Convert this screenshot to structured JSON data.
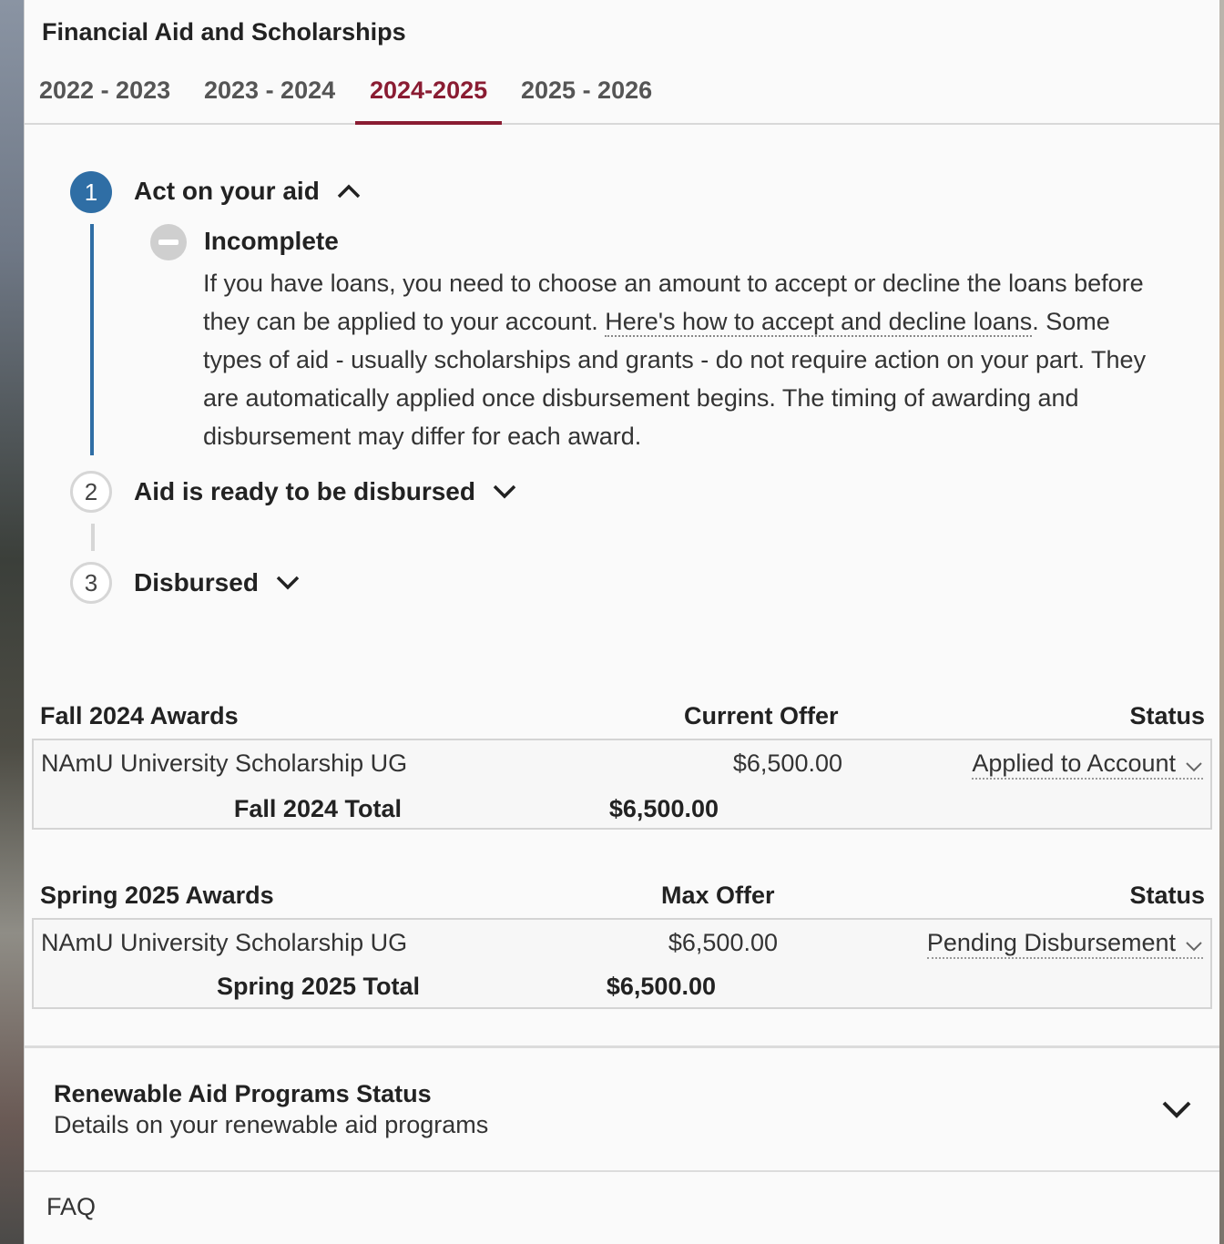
{
  "panel": {
    "title": "Financial Aid and Scholarships"
  },
  "tabs": [
    {
      "label": "2022 - 2023",
      "active": false
    },
    {
      "label": "2023 - 2024",
      "active": false
    },
    {
      "label": "2024-2025",
      "active": true
    },
    {
      "label": "2025 - 2026",
      "active": false
    }
  ],
  "steps": [
    {
      "number": "1",
      "title": "Act on your aid",
      "expanded": true
    },
    {
      "number": "2",
      "title": "Aid is ready to be disbursed",
      "expanded": false
    },
    {
      "number": "3",
      "title": "Disbursed",
      "expanded": false
    }
  ],
  "step1_detail": {
    "status": "Incomplete",
    "text_before_link": "If you have loans, you need to choose an amount to accept or decline the loans before they can be applied to your account. ",
    "link": "Here's how to accept and decline loans",
    "text_after_link": ". Some types of aid - usually scholarships and grants - do not require action on your part. They are automatically applied once disbursement begins. The timing of awarding and disbursement may differ for each award."
  },
  "fall": {
    "heading": "Fall 2024 Awards",
    "offer_heading": "Current Offer",
    "status_heading": "Status",
    "award_name": "NAmU University Scholarship UG",
    "award_amount": "$6,500.00",
    "award_status": "Applied to Account",
    "total_label": "Fall 2024 Total",
    "total_amount": "$6,500.00"
  },
  "spring": {
    "heading": "Spring 2025 Awards",
    "offer_heading": "Max Offer",
    "status_heading": "Status",
    "award_name": "NAmU University Scholarship UG",
    "award_amount": "$6,500.00",
    "award_status": "Pending Disbursement",
    "total_label": "Spring 2025 Total",
    "total_amount": "$6,500.00"
  },
  "renewable": {
    "title": "Renewable Aid Programs Status",
    "subtitle": "Details on your renewable aid programs"
  },
  "faq": {
    "label": "FAQ"
  },
  "colors": {
    "accent": "#8a1c32",
    "step_active": "#2f6ea5"
  }
}
